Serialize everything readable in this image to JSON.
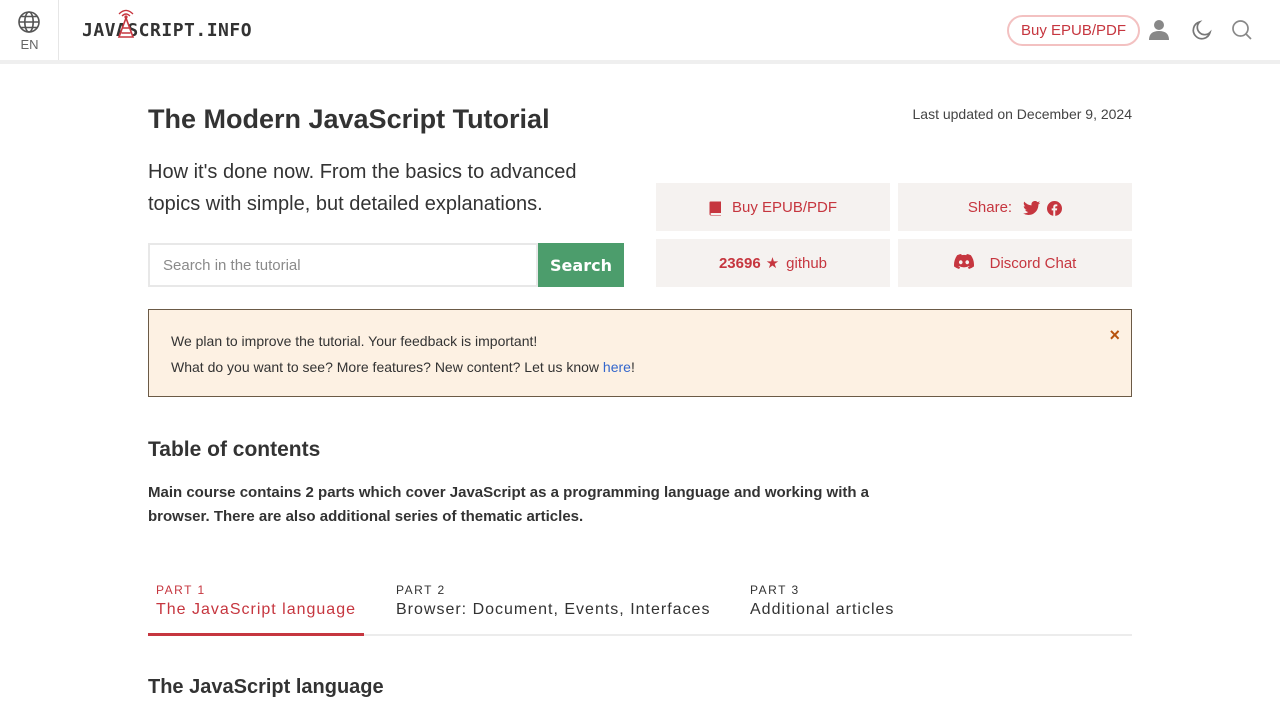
{
  "header": {
    "lang_code": "EN",
    "logo_text": "JAVASCRIPT.INFO",
    "buy_label": "Buy EPUB/PDF",
    "icons": [
      "globe-icon",
      "user-icon",
      "moon-icon",
      "search-icon"
    ]
  },
  "hero": {
    "title": "The Modern JavaScript Tutorial",
    "last_updated": "Last updated on December 9, 2024",
    "lead": "How it's done now. From the basics to advanced topics with simple, but detailed explanations.",
    "search_placeholder": "Search in the tutorial",
    "search_button": "Search",
    "buy_label": "Buy EPUB/PDF",
    "share_label": "Share:",
    "github_count": "23696",
    "github_star": "★",
    "github_label": "github",
    "discord_label": "Discord Chat"
  },
  "notice": {
    "line1": "We plan to improve the tutorial. Your feedback is important!",
    "line2_before": "What do you want to see? More features? New content? Let us know ",
    "link_text": "here",
    "line2_after": "!",
    "close": "×"
  },
  "toc": {
    "heading": "Table of contents",
    "description": "Main course contains 2 parts which cover JavaScript as a programming language and working with a browser. There are also additional series of thematic articles.",
    "tabs": [
      {
        "num": "PART 1",
        "name": "The JavaScript language",
        "active": true
      },
      {
        "num": "PART 2",
        "name": "Browser: Document, Events, Interfaces",
        "active": false
      },
      {
        "num": "PART 3",
        "name": "Additional articles",
        "active": false
      }
    ],
    "section_title": "The JavaScript language"
  },
  "colors": {
    "accent": "#c6363f",
    "search_button": "#4c9d6c",
    "tile_bg": "#f5f2f0",
    "notice_bg": "#fdf1e3",
    "link": "#3366cc"
  }
}
